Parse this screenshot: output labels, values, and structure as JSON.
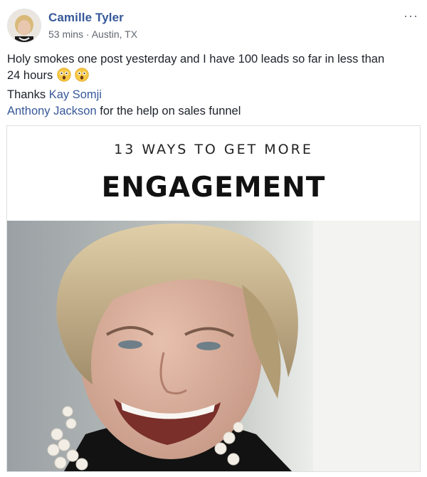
{
  "post": {
    "author": "Camille Tyler",
    "time": "53 mins",
    "separator": "·",
    "location": "Austin, TX",
    "options_label": "···",
    "text": {
      "line1": "Holy smokes one post yesterday and I have 100 leads so far in less than",
      "line2": "24 hours",
      "thanks_prefix": "Thanks ",
      "mention1": "Kay Somji",
      "mention2": "Anthony Jackson",
      "line4_suffix": " for the help on sales funnel"
    },
    "emojis": [
      "astonished-face-icon",
      "astonished-face-icon"
    ],
    "link_color": "#365899"
  },
  "media": {
    "kicker": "13 WAYS TO GET MORE",
    "headline": "ENGAGEMENT"
  }
}
